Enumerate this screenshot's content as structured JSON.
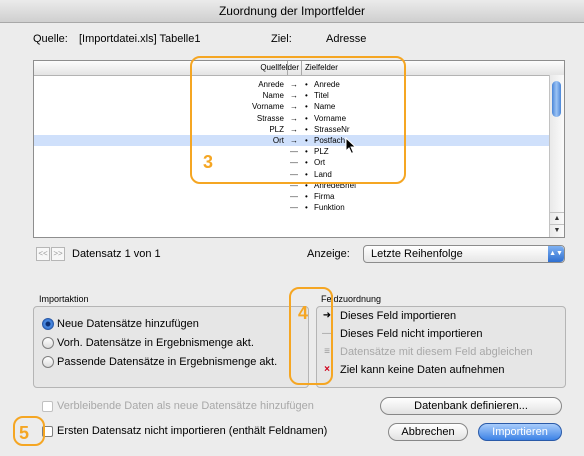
{
  "window": {
    "title": "Zuordnung der Importfelder"
  },
  "header": {
    "source_label": "Quelle:",
    "source_value": "[Importdatei.xls] Tabelle1",
    "target_label": "Ziel:",
    "target_value": "Adresse"
  },
  "table": {
    "col_source": "Quellfelder",
    "col_target": "Zielfelder",
    "rows": [
      {
        "source": "Anrede",
        "mark": "→",
        "target": "Anrede"
      },
      {
        "source": "Name",
        "mark": "→",
        "target": "Titel"
      },
      {
        "source": "Vorname",
        "mark": "→",
        "target": "Name"
      },
      {
        "source": "Strasse",
        "mark": "→",
        "target": "Vorname"
      },
      {
        "source": "PLZ",
        "mark": "→",
        "target": "StrasseNr"
      },
      {
        "source": "Ort",
        "mark": "→",
        "target": "Postfach"
      },
      {
        "source": "",
        "mark": "—",
        "target": "PLZ"
      },
      {
        "source": "",
        "mark": "—",
        "target": "Ort"
      },
      {
        "source": "",
        "mark": "—",
        "target": "Land"
      },
      {
        "source": "",
        "mark": "—",
        "target": "AnredeBrief"
      },
      {
        "source": "",
        "mark": "—",
        "target": "Firma"
      },
      {
        "source": "",
        "mark": "—",
        "target": "Funktion"
      }
    ]
  },
  "nav": {
    "prev": "<<",
    "next": ">>",
    "record_text": "Datensatz 1 von 1",
    "display_label": "Anzeige:",
    "display_value": "Letzte Reihenfolge"
  },
  "import_action": {
    "title": "Importaktion",
    "options": [
      "Neue Datensätze hinzufügen",
      "Vorh. Datensätze in Ergebnismenge akt.",
      "Passende Datensätze in Ergebnismenge akt."
    ]
  },
  "field_mapping": {
    "title": "Feldzuordnung",
    "items": [
      "Dieses Feld importieren",
      "Dieses Feld nicht importieren",
      "Datensätze mit diesem Feld abgleichen",
      "Ziel kann keine Daten aufnehmen"
    ]
  },
  "options": {
    "remaining_data": "Verbleibende Daten als neue Datensätze hinzufügen",
    "skip_first": "Ersten Datensatz nicht importieren (enthält Feldnamen)"
  },
  "buttons": {
    "define_db": "Datenbank definieren...",
    "cancel": "Abbrechen",
    "import": "Importieren"
  },
  "callouts": {
    "c3": "3",
    "c4": "4",
    "c5": "5"
  },
  "colors": {
    "accent": "#3c82e6",
    "callout": "#f5a623",
    "error": "#d0021b"
  }
}
